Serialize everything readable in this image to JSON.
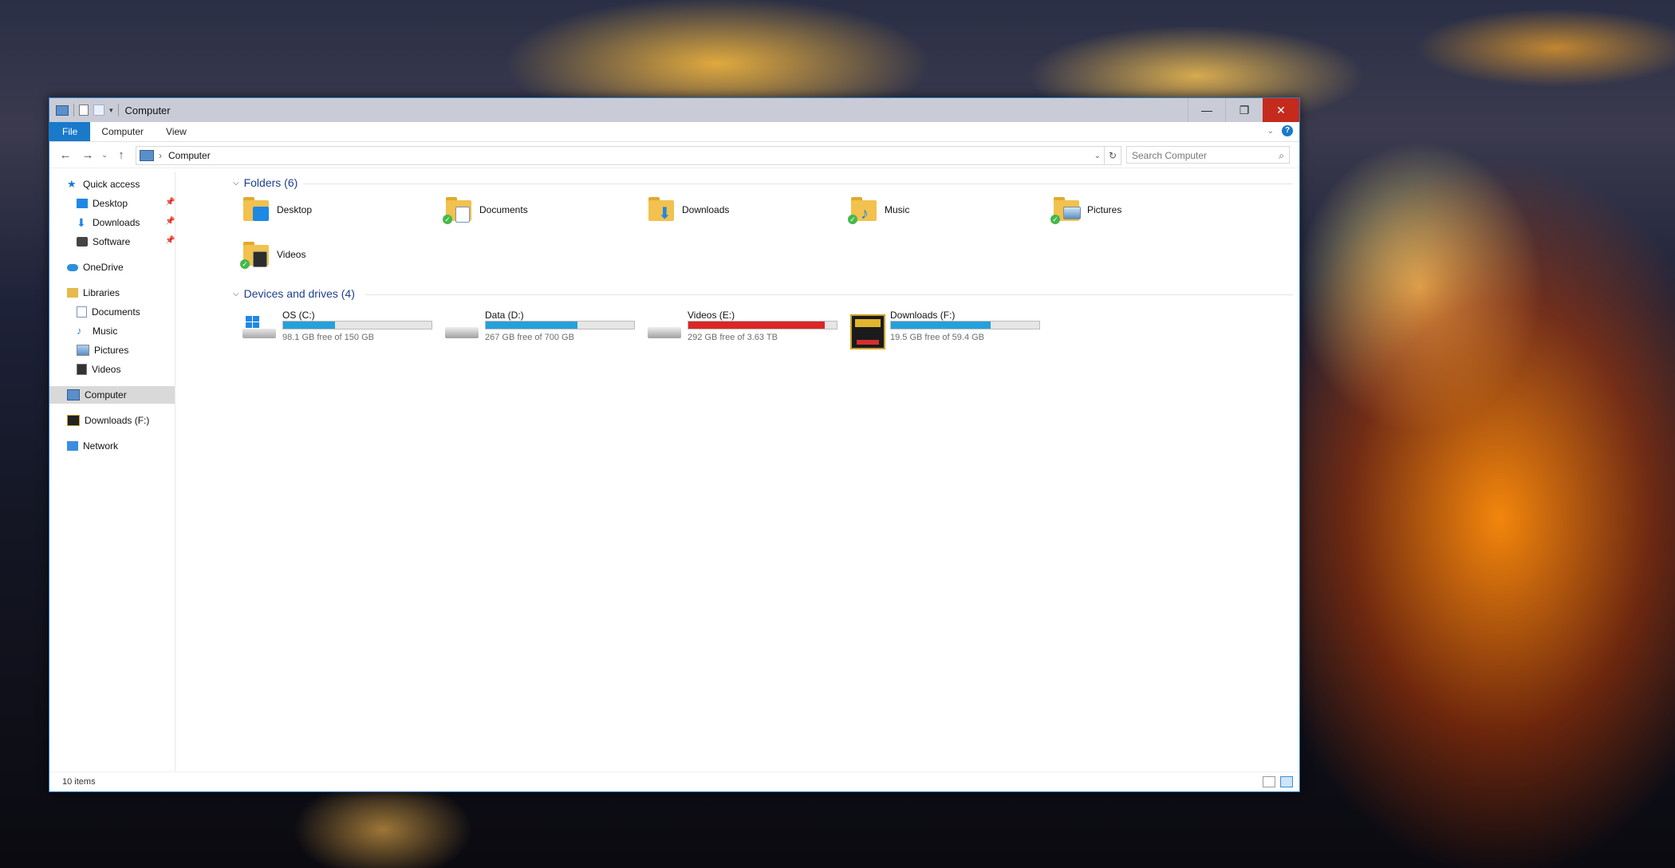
{
  "window": {
    "title": "Computer"
  },
  "ribbon": {
    "tabs": [
      "File",
      "Computer",
      "View"
    ]
  },
  "address": {
    "path": "Computer",
    "search_placeholder": "Search Computer"
  },
  "sidebar": {
    "items": [
      {
        "label": "Quick access",
        "icon": "star-icon"
      },
      {
        "label": "Desktop",
        "icon": "desktop-icon",
        "pinned": true
      },
      {
        "label": "Downloads",
        "icon": "downloads-icon",
        "pinned": true
      },
      {
        "label": "Software",
        "icon": "software-icon",
        "pinned": true
      },
      {
        "label": "OneDrive",
        "icon": "cloud-icon"
      },
      {
        "label": "Libraries",
        "icon": "library-icon"
      },
      {
        "label": "Documents",
        "icon": "documents-icon"
      },
      {
        "label": "Music",
        "icon": "music-icon"
      },
      {
        "label": "Pictures",
        "icon": "pictures-icon"
      },
      {
        "label": "Videos",
        "icon": "videos-icon"
      },
      {
        "label": "Computer",
        "icon": "computer-icon",
        "selected": true
      },
      {
        "label": "Downloads (F:)",
        "icon": "sdcard-icon"
      },
      {
        "label": "Network",
        "icon": "network-icon"
      }
    ]
  },
  "folders": {
    "heading": "Folders (6)",
    "items": [
      {
        "name": "Desktop",
        "synced": false
      },
      {
        "name": "Documents",
        "synced": true
      },
      {
        "name": "Downloads",
        "synced": false
      },
      {
        "name": "Music",
        "synced": true
      },
      {
        "name": "Pictures",
        "synced": true
      },
      {
        "name": "Videos",
        "synced": true
      }
    ]
  },
  "drives": {
    "heading": "Devices and drives (4)",
    "items": [
      {
        "name": "OS (C:)",
        "free": "98.1 GB free of 150 GB",
        "used_fraction": 0.35,
        "critical": false,
        "icon": "windows-drive-icon"
      },
      {
        "name": "Data (D:)",
        "free": "267 GB free of 700 GB",
        "used_fraction": 0.62,
        "critical": false,
        "icon": "hard-drive-icon"
      },
      {
        "name": "Videos (E:)",
        "free": "292 GB free of 3.63 TB",
        "used_fraction": 0.92,
        "critical": true,
        "icon": "hard-drive-icon"
      },
      {
        "name": "Downloads (F:)",
        "free": "19.5 GB free of 59.4 GB",
        "used_fraction": 0.67,
        "critical": false,
        "icon": "sdcard-icon"
      }
    ]
  },
  "status": {
    "items": "10 items"
  },
  "colors": {
    "accent": "#1979ca",
    "drive_bar": "#26a0da",
    "drive_bar_critical": "#da2626",
    "folder": "#f2c14e"
  }
}
